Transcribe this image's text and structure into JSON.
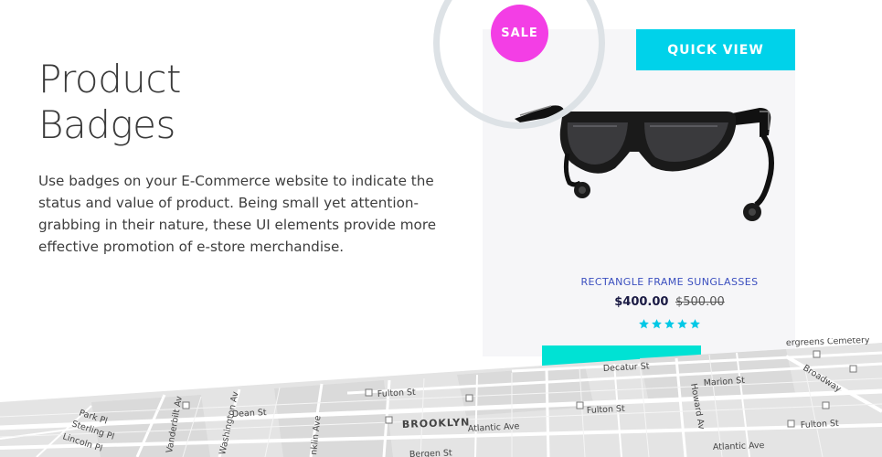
{
  "heading": {
    "line1": "Product",
    "line2": "Badges"
  },
  "description": "Use badges on your E-Commerce website to indicate the status and value of product. Being small yet attention-grabbing in their nature, these UI elements provide more effective promotion of e-store merchandise.",
  "product": {
    "badge": "SALE",
    "quick_view_label": "QUICK VIEW",
    "name": "RECTANGLE FRAME SUNGLASSES",
    "price": "$400.00",
    "old_price": "$500.00",
    "rating": 5
  },
  "map": {
    "streets": [
      "Decatur St",
      "Howard Av",
      "Marion St",
      "Broadway",
      "Fulton St",
      "Fulton St",
      "Fulton St",
      "Dean St",
      "Park Pl",
      "Sterling Pl",
      "Lincoln Pl",
      "Vanderbilt Av",
      "Washington Av",
      "nklin Ave",
      "Atlantic Ave",
      "Atlantic Ave",
      "Bergen St",
      "ergreens Cemetery"
    ],
    "neighborhood": "BROOKLYN"
  },
  "colors": {
    "sale_badge": "#f33ee5",
    "quick_view": "#00d2ea",
    "teal_bar": "#00e2d4",
    "product_name": "#3b4fbf",
    "stars": "#00c8e6"
  }
}
